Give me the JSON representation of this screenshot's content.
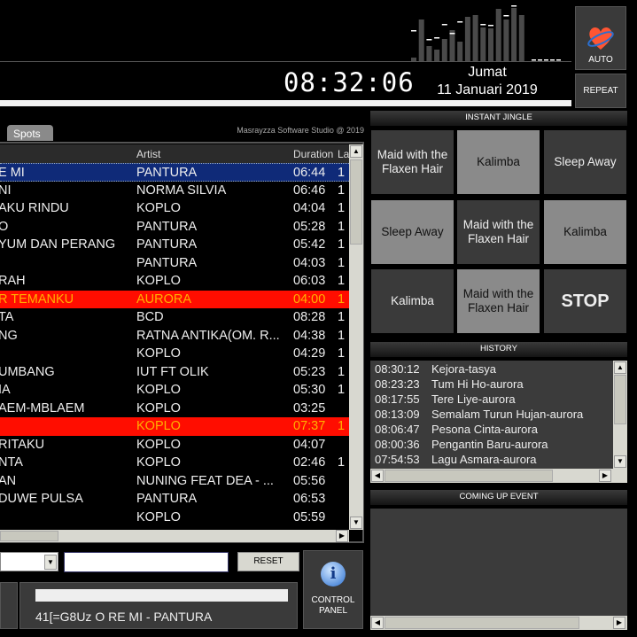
{
  "spectrum": {
    "levels": [
      4,
      47,
      17,
      13,
      25,
      35,
      22,
      50,
      52,
      38,
      37,
      59,
      47,
      60,
      52
    ],
    "peaks": [
      35,
      null,
      25,
      27,
      42,
      32,
      45,
      null,
      null,
      42,
      41,
      null,
      52,
      63,
      null
    ]
  },
  "clock": {
    "time": "08:32:06",
    "day": "Jumat",
    "date": "11 Januari 2019"
  },
  "buttons": {
    "auto": "AUTO",
    "repeat": "REPEAT",
    "reset": "RESET",
    "control_panel_1": "CONTROL",
    "control_panel_2": "PANEL"
  },
  "playlist": {
    "tab": "Spots",
    "copyright": "Masrayzza Software Studio @ 2019",
    "columns": [
      "Artist",
      "Duration",
      "La"
    ],
    "rows": [
      {
        "title": "E MI",
        "artist": "PANTURA",
        "duration": "06:44",
        "last": "1",
        "state": "selected"
      },
      {
        "title": "NI",
        "artist": " NORMA SILVIA",
        "duration": "06:46",
        "last": "1",
        "state": ""
      },
      {
        "title": "AKU RINDU",
        "artist": "KOPLO",
        "duration": "04:04",
        "last": "1",
        "state": ""
      },
      {
        "title": "O",
        "artist": "PANTURA",
        "duration": "05:28",
        "last": "1",
        "state": ""
      },
      {
        "title": "YUM DAN PERANG",
        "artist": "PANTURA",
        "duration": "05:42",
        "last": "1",
        "state": ""
      },
      {
        "title": "",
        "artist": "PANTURA",
        "duration": "04:03",
        "last": "1",
        "state": ""
      },
      {
        "title": "RAH",
        "artist": "KOPLO",
        "duration": "06:03",
        "last": "1",
        "state": ""
      },
      {
        "title": "R TEMANKU",
        "artist": "AURORA",
        "duration": "04:00",
        "last": "1",
        "state": "played"
      },
      {
        "title": "TA",
        "artist": "BCD",
        "duration": "08:28",
        "last": "1",
        "state": ""
      },
      {
        "title": "NG",
        "artist": "RATNA ANTIKA(OM. R...",
        "duration": "04:38",
        "last": "1",
        "state": ""
      },
      {
        "title": "",
        "artist": "KOPLO",
        "duration": "04:29",
        "last": "1",
        "state": ""
      },
      {
        "title": "UMBANG",
        "artist": "IUT FT OLIK",
        "duration": "05:23",
        "last": "1",
        "state": ""
      },
      {
        "title": "IA",
        "artist": "KOPLO",
        "duration": "05:30",
        "last": "1",
        "state": ""
      },
      {
        "title": "AEM-MBLAEM",
        "artist": "KOPLO",
        "duration": "03:25",
        "last": "",
        "state": ""
      },
      {
        "title": "",
        "artist": "KOPLO",
        "duration": "07:37",
        "last": "1",
        "state": "played"
      },
      {
        "title": "RITAKU",
        "artist": "KOPLO",
        "duration": "04:07",
        "last": "",
        "state": ""
      },
      {
        "title": "NTA",
        "artist": "KOPLO",
        "duration": "02:46",
        "last": "1",
        "state": ""
      },
      {
        "title": "AN",
        "artist": "NUNING FEAT DEA - ...",
        "duration": "05:56",
        "last": "",
        "state": ""
      },
      {
        "title": "DUWE PULSA",
        "artist": "PANTURA",
        "duration": "06:53",
        "last": "",
        "state": ""
      },
      {
        "title": "",
        "artist": "KOPLO",
        "duration": "05:59",
        "last": "",
        "state": ""
      }
    ]
  },
  "search": {
    "value": ""
  },
  "now_playing": {
    "text": "41[=G8Uz O RE MI - PANTURA",
    "progress": 1.0
  },
  "instant_jingle": {
    "title": "INSTANT JINGLE",
    "cells": [
      {
        "label": "Maid with the Flaxen Hair",
        "tone": "dark"
      },
      {
        "label": "Kalimba",
        "tone": "light"
      },
      {
        "label": "Sleep Away",
        "tone": "dark"
      },
      {
        "label": "Sleep Away",
        "tone": "light"
      },
      {
        "label": "Maid with the Flaxen Hair",
        "tone": "dark"
      },
      {
        "label": "Kalimba",
        "tone": "light"
      },
      {
        "label": "Kalimba",
        "tone": "dark"
      },
      {
        "label": "Maid with the Flaxen Hair",
        "tone": "light"
      },
      {
        "label": "STOP",
        "tone": "stop"
      }
    ]
  },
  "history": {
    "title": "HISTORY",
    "items": [
      {
        "time": "08:30:12",
        "song": "Kejora-tasya"
      },
      {
        "time": "08:23:23",
        "song": "Tum Hi Ho-aurora"
      },
      {
        "time": "08:17:55",
        "song": "Tere Liye-aurora"
      },
      {
        "time": "08:13:09",
        "song": "Semalam Turun Hujan-aurora"
      },
      {
        "time": "08:06:47",
        "song": "Pesona Cinta-aurora"
      },
      {
        "time": "08:00:36",
        "song": "Pengantin Baru-aurora"
      },
      {
        "time": "07:54:53",
        "song": "Lagu Asmara-aurora"
      }
    ]
  },
  "coming_up": {
    "title": "COMING UP EVENT"
  },
  "colors": {
    "selected_row": "#0f2a78",
    "played_row": "#ff0d00",
    "played_text": "#ffb000"
  }
}
